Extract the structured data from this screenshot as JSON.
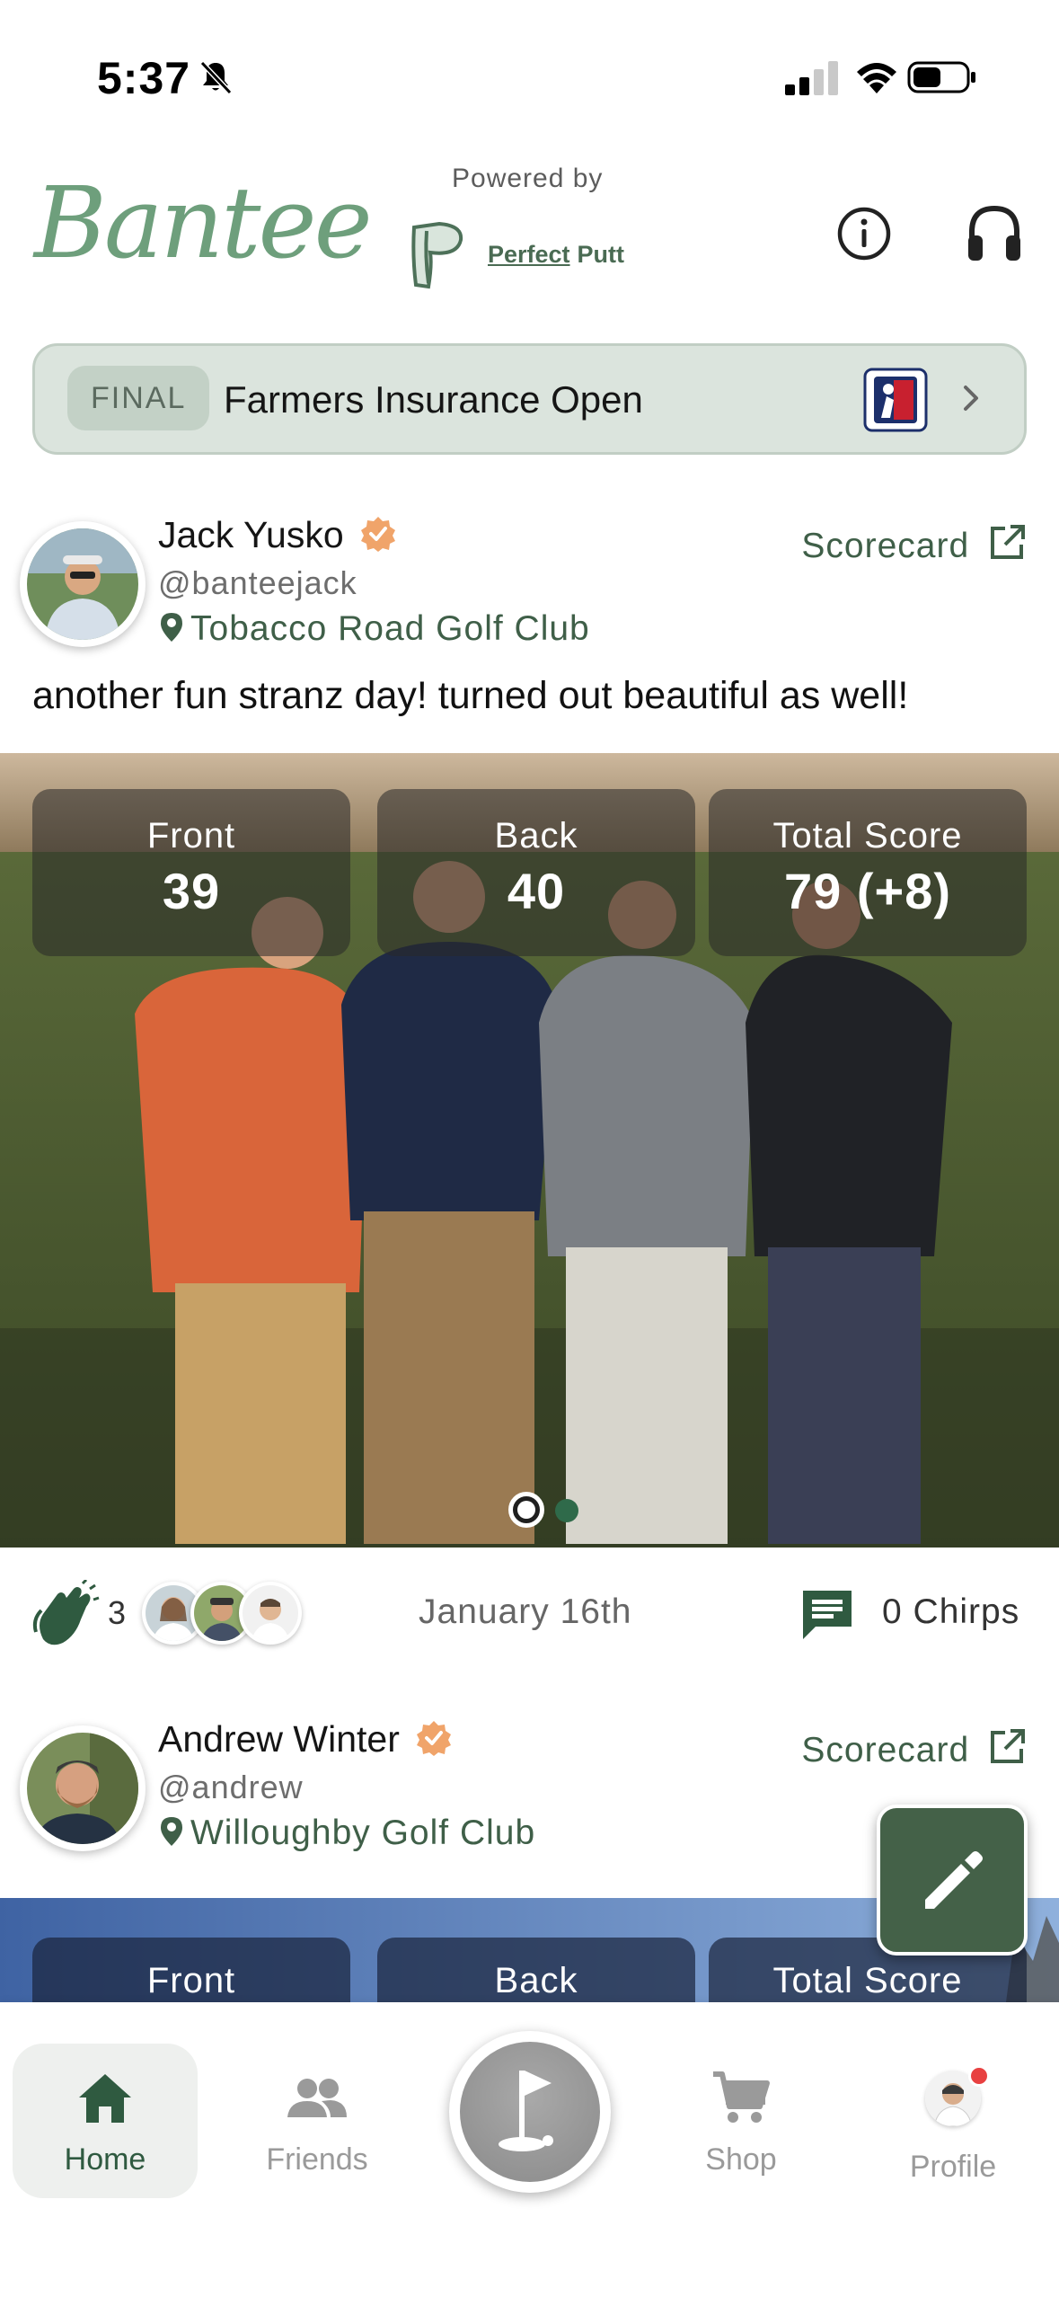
{
  "status_bar": {
    "time": "5:37"
  },
  "header": {
    "logo_text": "Bantee",
    "powered_by": "Powered by",
    "partner_part1": "Perfect",
    "partner_part2": "Putt"
  },
  "tournament": {
    "status": "FINAL",
    "name": "Farmers Insurance Open"
  },
  "posts": [
    {
      "name": "Jack Yusko",
      "handle": "@banteejack",
      "location": "Tobacco Road Golf Club",
      "scorecard_label": "Scorecard",
      "caption": "another fun stranz day! turned out beautiful as well!",
      "scores": [
        {
          "label": "Front",
          "value": "39"
        },
        {
          "label": "Back",
          "value": "40"
        },
        {
          "label": "Total Score",
          "value": "79 (+8)"
        }
      ],
      "claps": "3",
      "date": "January 16th",
      "chirps": "0 Chirps",
      "carousel_index": 1,
      "carousel_total": 2
    },
    {
      "name": "Andrew Winter",
      "handle": "@andrew",
      "location": "Willoughby Golf Club",
      "scorecard_label": "Scorecard",
      "scores": [
        {
          "label": "Front"
        },
        {
          "label": "Back"
        },
        {
          "label": "Total Score"
        }
      ]
    }
  ],
  "tabs": [
    {
      "label": "Home",
      "icon": "home-icon",
      "active": true
    },
    {
      "label": "Friends",
      "icon": "friends-icon",
      "active": false
    },
    {
      "label": "Shop",
      "icon": "cart-icon",
      "active": false
    },
    {
      "label": "Profile",
      "icon": "profile-avatar",
      "active": false
    }
  ],
  "colors": {
    "brand_green": "#6e9f7c",
    "dark_green": "#446148",
    "banner_bg": "#dbe4dd",
    "verified_orange": "#f0a46a",
    "notification_red": "#e84141"
  }
}
